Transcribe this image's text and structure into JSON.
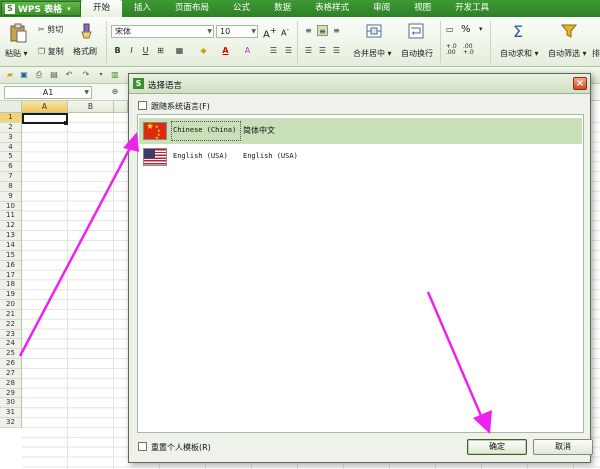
{
  "app": {
    "name": "WPS 表格",
    "logo": "S"
  },
  "menu": {
    "tabs": [
      "开始",
      "插入",
      "页面布局",
      "公式",
      "数据",
      "表格样式",
      "审阅",
      "视图",
      "开发工具"
    ],
    "active_index": 0
  },
  "ribbon": {
    "paste": "粘贴",
    "cut": "剪切",
    "copy": "复制",
    "format_painter": "格式刷",
    "font_name": "宋体",
    "font_size": "10",
    "bold": "B",
    "italic": "I",
    "underline": "U",
    "merge_center": "合并居中",
    "wrap_text": "自动换行",
    "auto_sum": "自动求和",
    "auto_filter": "自动筛选",
    "percent": "%",
    "dec_inc": "+.0 .00",
    "dec_dec": ".00 +.0",
    "sort": "排"
  },
  "formula_bar": {
    "cell_ref": "A1"
  },
  "sheet": {
    "columns": [
      "A",
      "B"
    ],
    "selected_column": "A",
    "rows": [
      "1",
      "2",
      "3",
      "4",
      "5",
      "6",
      "7",
      "8",
      "9",
      "10",
      "11",
      "12",
      "13",
      "14",
      "15",
      "16",
      "17",
      "18",
      "19",
      "20",
      "21",
      "22",
      "23",
      "24",
      "25",
      "26",
      "27",
      "28",
      "29",
      "30",
      "31",
      "32"
    ],
    "selected_row": "1"
  },
  "dialog": {
    "logo": "S",
    "title": "选择语言",
    "follow_system": "跟随系统语言(F)",
    "reset_template": "重置个人模板(R)",
    "languages": [
      {
        "code": "Chinese (China)",
        "name": "简体中文",
        "flag": "flag-china-icon",
        "selected": true
      },
      {
        "code": "English (USA)",
        "name": "English (USA)",
        "flag": "flag-usa-icon",
        "selected": false
      }
    ],
    "ok": "确定",
    "cancel": "取消",
    "close": "×"
  },
  "colors": {
    "brand_green": "#3b8f2d",
    "selection_green": "#c9dfb8",
    "arrow_magenta": "#ee22ee"
  }
}
